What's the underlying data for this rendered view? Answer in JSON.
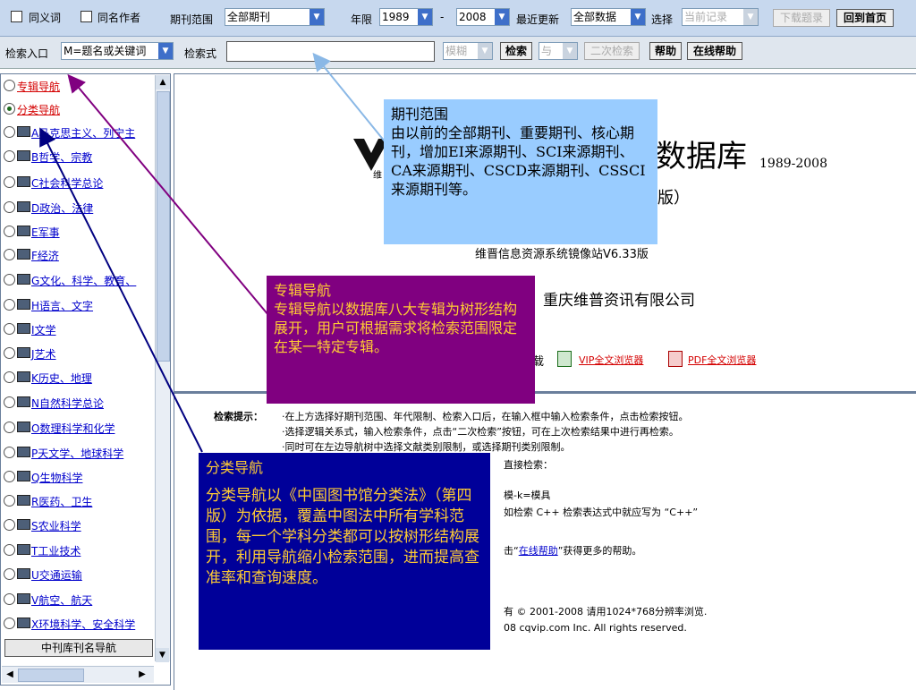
{
  "toolbar": {
    "synonym_label": "同义词",
    "same_author_label": "同名作者",
    "journal_range_label": "期刊范围",
    "journal_range_value": "全部期刊",
    "year_limit_label": "年限",
    "year_from": "1989",
    "dash": "-",
    "year_to": "2008",
    "recent_update_label": "最近更新",
    "recent_update_value": "全部数据",
    "select_label": "选择",
    "current_record_value": "当前记录",
    "download_button": "下载题录",
    "home_button": "回到首页"
  },
  "search": {
    "entry_label": "检索入口",
    "entry_value": "M=题名或关键词",
    "expr_label": "检索式",
    "expr_value": "",
    "fuzzy_value": "模糊",
    "search_button": "检索",
    "and_value": "与",
    "secondary_button": "二次检索",
    "help_button": "帮助",
    "online_help_button": "在线帮助"
  },
  "tree": {
    "items": [
      {
        "label": "专辑导航"
      },
      {
        "label": "分类导航"
      },
      {
        "label": "A马克思主义、列宁主"
      },
      {
        "label": "B哲学、宗教"
      },
      {
        "label": "C社会科学总论"
      },
      {
        "label": "D政治、法律"
      },
      {
        "label": "E军事"
      },
      {
        "label": "F经济"
      },
      {
        "label": "G文化、科学、教育、"
      },
      {
        "label": "H语言、文字"
      },
      {
        "label": "I文学"
      },
      {
        "label": "J艺术"
      },
      {
        "label": "K历史、地理"
      },
      {
        "label": "N自然科学总论"
      },
      {
        "label": "O数理科学和化学"
      },
      {
        "label": "P天文学、地球科学"
      },
      {
        "label": "Q生物科学"
      },
      {
        "label": "R医药、卫生"
      },
      {
        "label": "S农业科学"
      },
      {
        "label": "T工业技术"
      },
      {
        "label": "U交通运输"
      },
      {
        "label": "V航空、航天"
      },
      {
        "label": "X环境科学、安全科学"
      }
    ],
    "bottom_button": "中刊库刊名导航"
  },
  "main": {
    "db_title_fragment": "数据库",
    "db_years": "1989-2008",
    "edition_fragment": "版）",
    "logo_fragment": "维",
    "mirror_version": "维晋信息资源系统镜像站V6.33版",
    "company": "重庆维普资讯有限公司",
    "download_fragment": "载",
    "vip_browser": "VIP全文浏览器",
    "pdf_browser": "PDF全文浏览器"
  },
  "hints": {
    "label": "检索提示：",
    "line1": "·在上方选择好期刊范围、年代限制、检索入口后，在输入框中输入检索条件，点击检索按钮。",
    "line2": "·选择逻辑关系式，输入检索条件，点击“二次检索”按钮，可在上次检索结果中进行再检索。",
    "line3": "·同时可在左边导航树中选择文献类别限制，或选择期刊类别限制。",
    "line4": "直接检索：",
    "line5": "模-k=模具",
    "line6": "如检索 C++ 检索表达式中就应写为 “C++”",
    "line7_pre": "击“",
    "line7_link": "在线帮助",
    "line7_post": "”获得更多的帮助。",
    "copyright1": "有 © 2001-2008 请用1024*768分辨率浏览.",
    "copyright2": "08 cqvip.com Inc. All rights reserved."
  },
  "callouts": {
    "journal": {
      "title": "期刊范围",
      "body": "由以前的全部期刊、重要期刊、核心期刊，增加EI来源期刊、SCI来源期刊、CA来源期刊、CSCD来源期刊、CSSCI来源期刊等。",
      "bg": "#99ccff"
    },
    "album": {
      "title": "专辑导航",
      "body": "专辑导航以数据库八大专辑为树形结构展开，用户可根据需求将检索范围限定在某一特定专辑。",
      "bg": "#800080"
    },
    "category": {
      "title": "分类导航",
      "body": "分类导航以《中国图书馆分类法》（第四版）为依据，覆盖中图法中所有学科范围，每一个学科分类都可以按树形结构展开，利用导航缩小检索范围，进而提高查准率和查询速度。",
      "bg": "#000099"
    }
  }
}
